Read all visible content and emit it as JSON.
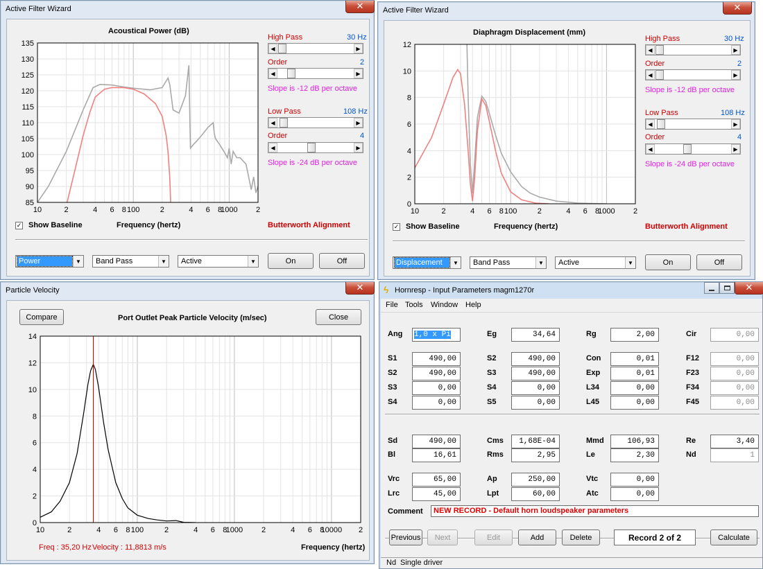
{
  "win1": {
    "title": "Active Filter Wizard",
    "chart_title": "Acoustical Power (dB)",
    "high_pass_label": "High Pass",
    "high_pass_value": "30 Hz",
    "hp_order_label": "Order",
    "hp_order_value": "2",
    "hp_slope": "Slope is -12 dB per octave",
    "low_pass_label": "Low Pass",
    "low_pass_value": "108 Hz",
    "lp_order_label": "Order",
    "lp_order_value": "4",
    "lp_slope": "Slope is -24 dB per octave",
    "show_baseline": "Show Baseline",
    "xlabel": "Frequency (hertz)",
    "alignment": "Butterworth Alignment",
    "dropdown1": "Power",
    "dropdown2": "Band Pass",
    "dropdown3": "Active",
    "on_label": "On",
    "off_label": "Off"
  },
  "win2": {
    "title": "Active Filter Wizard",
    "chart_title": "Diaphragm Displacement (mm)",
    "high_pass_label": "High Pass",
    "high_pass_value": "30 Hz",
    "hp_order_label": "Order",
    "hp_order_value": "2",
    "hp_slope": "Slope is -12 dB per octave",
    "low_pass_label": "Low Pass",
    "low_pass_value": "108 Hz",
    "lp_order_label": "Order",
    "lp_order_value": "4",
    "lp_slope": "Slope is -24 dB per octave",
    "show_baseline": "Show Baseline",
    "xlabel": "Frequency (hertz)",
    "alignment": "Butterworth Alignment",
    "dropdown1": "Displacement",
    "dropdown2": "Band Pass",
    "dropdown3": "Active",
    "on_label": "On",
    "off_label": "Off"
  },
  "win3": {
    "title": "Particle Velocity",
    "compare_label": "Compare",
    "chart_title": "Port Outlet Peak Particle Velocity (m/sec)",
    "close_label": "Close",
    "freq_readout": "Freq : 35,20 Hz",
    "velocity_readout": "Velocity : 11,8813 m/s",
    "xlabel": "Frequency (hertz)"
  },
  "win4": {
    "title": "Hornresp - Input Parameters   magm1270r",
    "menu": [
      "File",
      "Tools",
      "Window",
      "Help"
    ],
    "params": [
      {
        "label": "Ang",
        "value": "1,0 x Pi",
        "highlight": true
      },
      {
        "label": "Eg",
        "value": "34,64"
      },
      {
        "label": "Rg",
        "value": "2,00"
      },
      {
        "label": "Cir",
        "value": "0,00",
        "disabled": true
      },
      {
        "label": "S1",
        "value": "490,00"
      },
      {
        "label": "S2",
        "value": "490,00"
      },
      {
        "label": "Con",
        "value": "0,01"
      },
      {
        "label": "F12",
        "value": "0,00",
        "disabled": true
      },
      {
        "label": "S2",
        "value": "490,00"
      },
      {
        "label": "S3",
        "value": "490,00"
      },
      {
        "label": "Exp",
        "value": "0,01"
      },
      {
        "label": "F23",
        "value": "0,00",
        "disabled": true
      },
      {
        "label": "S3",
        "value": "0,00"
      },
      {
        "label": "S4",
        "value": "0,00"
      },
      {
        "label": "L34",
        "value": "0,00"
      },
      {
        "label": "F34",
        "value": "0,00",
        "disabled": true
      },
      {
        "label": "S4",
        "value": "0,00"
      },
      {
        "label": "S5",
        "value": "0,00"
      },
      {
        "label": "L45",
        "value": "0,00"
      },
      {
        "label": "F45",
        "value": "0,00",
        "disabled": true
      },
      {
        "label": "Sd",
        "value": "490,00"
      },
      {
        "label": "Cms",
        "value": "1,68E-04"
      },
      {
        "label": "Mmd",
        "value": "106,93"
      },
      {
        "label": "Re",
        "value": "3,40"
      },
      {
        "label": "Bl",
        "value": "16,61"
      },
      {
        "label": "Rms",
        "value": "2,95"
      },
      {
        "label": "Le",
        "value": "2,30"
      },
      {
        "label": "Nd",
        "value": "1",
        "disabled": true
      },
      {
        "label": "Vrc",
        "value": "65,00"
      },
      {
        "label": "Ap",
        "value": "250,00"
      },
      {
        "label": "Vtc",
        "value": "0,00"
      },
      {
        "label": "Lrc",
        "value": "45,00"
      },
      {
        "label": "Lpt",
        "value": "60,00"
      },
      {
        "label": "Atc",
        "value": "0,00"
      }
    ],
    "comment_label": "Comment",
    "comment_value": "NEW RECORD - Default horn loudspeaker parameters",
    "buttons": {
      "previous": "Previous",
      "next": "Next",
      "edit": "Edit",
      "add": "Add",
      "delete": "Delete",
      "record": "Record 2 of 2",
      "calculate": "Calculate"
    },
    "status_key": "Nd",
    "status_text": "Single driver"
  },
  "chart_data": [
    {
      "type": "line",
      "title": "Acoustical Power (dB)",
      "xlabel": "Frequency (hertz)",
      "x_scale": "log",
      "xlim": [
        10,
        2000
      ],
      "ylim": [
        85,
        135
      ],
      "yticks": [
        85,
        90,
        95,
        100,
        105,
        110,
        115,
        120,
        125,
        130,
        135
      ],
      "xtick_labels": [
        "10",
        "2",
        "4",
        "6",
        "8",
        "100",
        "2",
        "4",
        "6",
        "8",
        "1000",
        "2"
      ],
      "series": [
        {
          "color": "#a9a9a9",
          "x": [
            10,
            13,
            20,
            30,
            38,
            45,
            60,
            80,
            100,
            150,
            200,
            230,
            240,
            260,
            300,
            350,
            380,
            390,
            395,
            420,
            500,
            600,
            680,
            700,
            720,
            800,
            900,
            960,
            1000,
            1050,
            1100,
            1200,
            1300,
            1500,
            1700,
            1800,
            1900,
            2000
          ],
          "y": [
            85,
            90,
            101,
            114,
            121,
            122,
            121.8,
            121.2,
            120.8,
            120.3,
            121,
            124,
            122,
            114,
            113,
            118.5,
            128,
            109,
            102,
            103,
            105.5,
            108.5,
            110,
            106.5,
            105,
            103,
            100.5,
            99,
            102,
            97,
            101,
            99,
            99,
            97,
            89,
            93,
            88,
            90
          ]
        },
        {
          "color": "#f08080",
          "x": [
            10,
            20,
            25,
            30,
            35,
            40,
            50,
            60,
            80,
            100,
            130,
            170,
            200,
            220,
            230,
            240,
            245
          ],
          "y": [
            50,
            84,
            96,
            106,
            113,
            118,
            120.5,
            121,
            121,
            120.5,
            119,
            116,
            112,
            106,
            101,
            93,
            85
          ]
        }
      ]
    },
    {
      "type": "line",
      "title": "Diaphragm Displacement (mm)",
      "xlabel": "Frequency (hertz)",
      "x_scale": "log",
      "xlim": [
        10,
        2000
      ],
      "ylim": [
        0,
        12
      ],
      "yticks": [
        0,
        2,
        4,
        6,
        8,
        10,
        12
      ],
      "xtick_labels": [
        "10",
        "2",
        "4",
        "6",
        "8",
        "100",
        "2",
        "4",
        "6",
        "8",
        "1000",
        "2"
      ],
      "series": [
        {
          "color": "#a9a9a9",
          "x": [
            35,
            36,
            38,
            40,
            42,
            45,
            50,
            55,
            60,
            70,
            80,
            100,
            130,
            160,
            200,
            300,
            500,
            800,
            1000
          ],
          "y": [
            12,
            8,
            3,
            0.8,
            3,
            6.5,
            8.1,
            7.7,
            6.8,
            5.1,
            3.8,
            2.4,
            1.3,
            0.8,
            0.5,
            0.2,
            0.05,
            0.01,
            0
          ]
        },
        {
          "color": "#f08080",
          "x": [
            10,
            15,
            20,
            25,
            28,
            30,
            33,
            36,
            38,
            40,
            42,
            45,
            50,
            55,
            60,
            70,
            80,
            100,
            130,
            180,
            250
          ],
          "y": [
            2.7,
            5,
            7.5,
            9.5,
            10.1,
            9.8,
            7.5,
            4,
            1.5,
            0.2,
            1.8,
            5.5,
            7.9,
            7.4,
            6.2,
            3.9,
            2.3,
            0.9,
            0.3,
            0.05,
            0
          ]
        }
      ]
    },
    {
      "type": "line",
      "title": "Port Outlet Peak Particle Velocity (m/sec)",
      "xlabel": "Frequency (hertz)",
      "x_scale": "log",
      "xlim": [
        10,
        20000
      ],
      "ylim": [
        0,
        14
      ],
      "yticks": [
        0,
        2,
        4,
        6,
        8,
        10,
        12,
        14
      ],
      "xtick_labels": [
        "10",
        "2",
        "4",
        "6",
        "8",
        "100",
        "2",
        "4",
        "6",
        "8",
        "1000",
        "2",
        "4",
        "6",
        "8",
        "10000",
        "2"
      ],
      "marker_x": 35.2,
      "series": [
        {
          "color": "#000000",
          "x": [
            10,
            13,
            16,
            20,
            24,
            28,
            31,
            33,
            35.2,
            37,
            40,
            45,
            50,
            60,
            70,
            80,
            100,
            130,
            160,
            200,
            250,
            300,
            400
          ],
          "y": [
            0.4,
            0.8,
            1.6,
            3.0,
            5.2,
            8.2,
            10.4,
            11.4,
            11.88,
            11.5,
            10.1,
            7.5,
            5.5,
            3.0,
            1.8,
            1.1,
            0.55,
            0.3,
            0.2,
            0.12,
            0.15,
            0.02,
            0
          ]
        }
      ]
    }
  ]
}
